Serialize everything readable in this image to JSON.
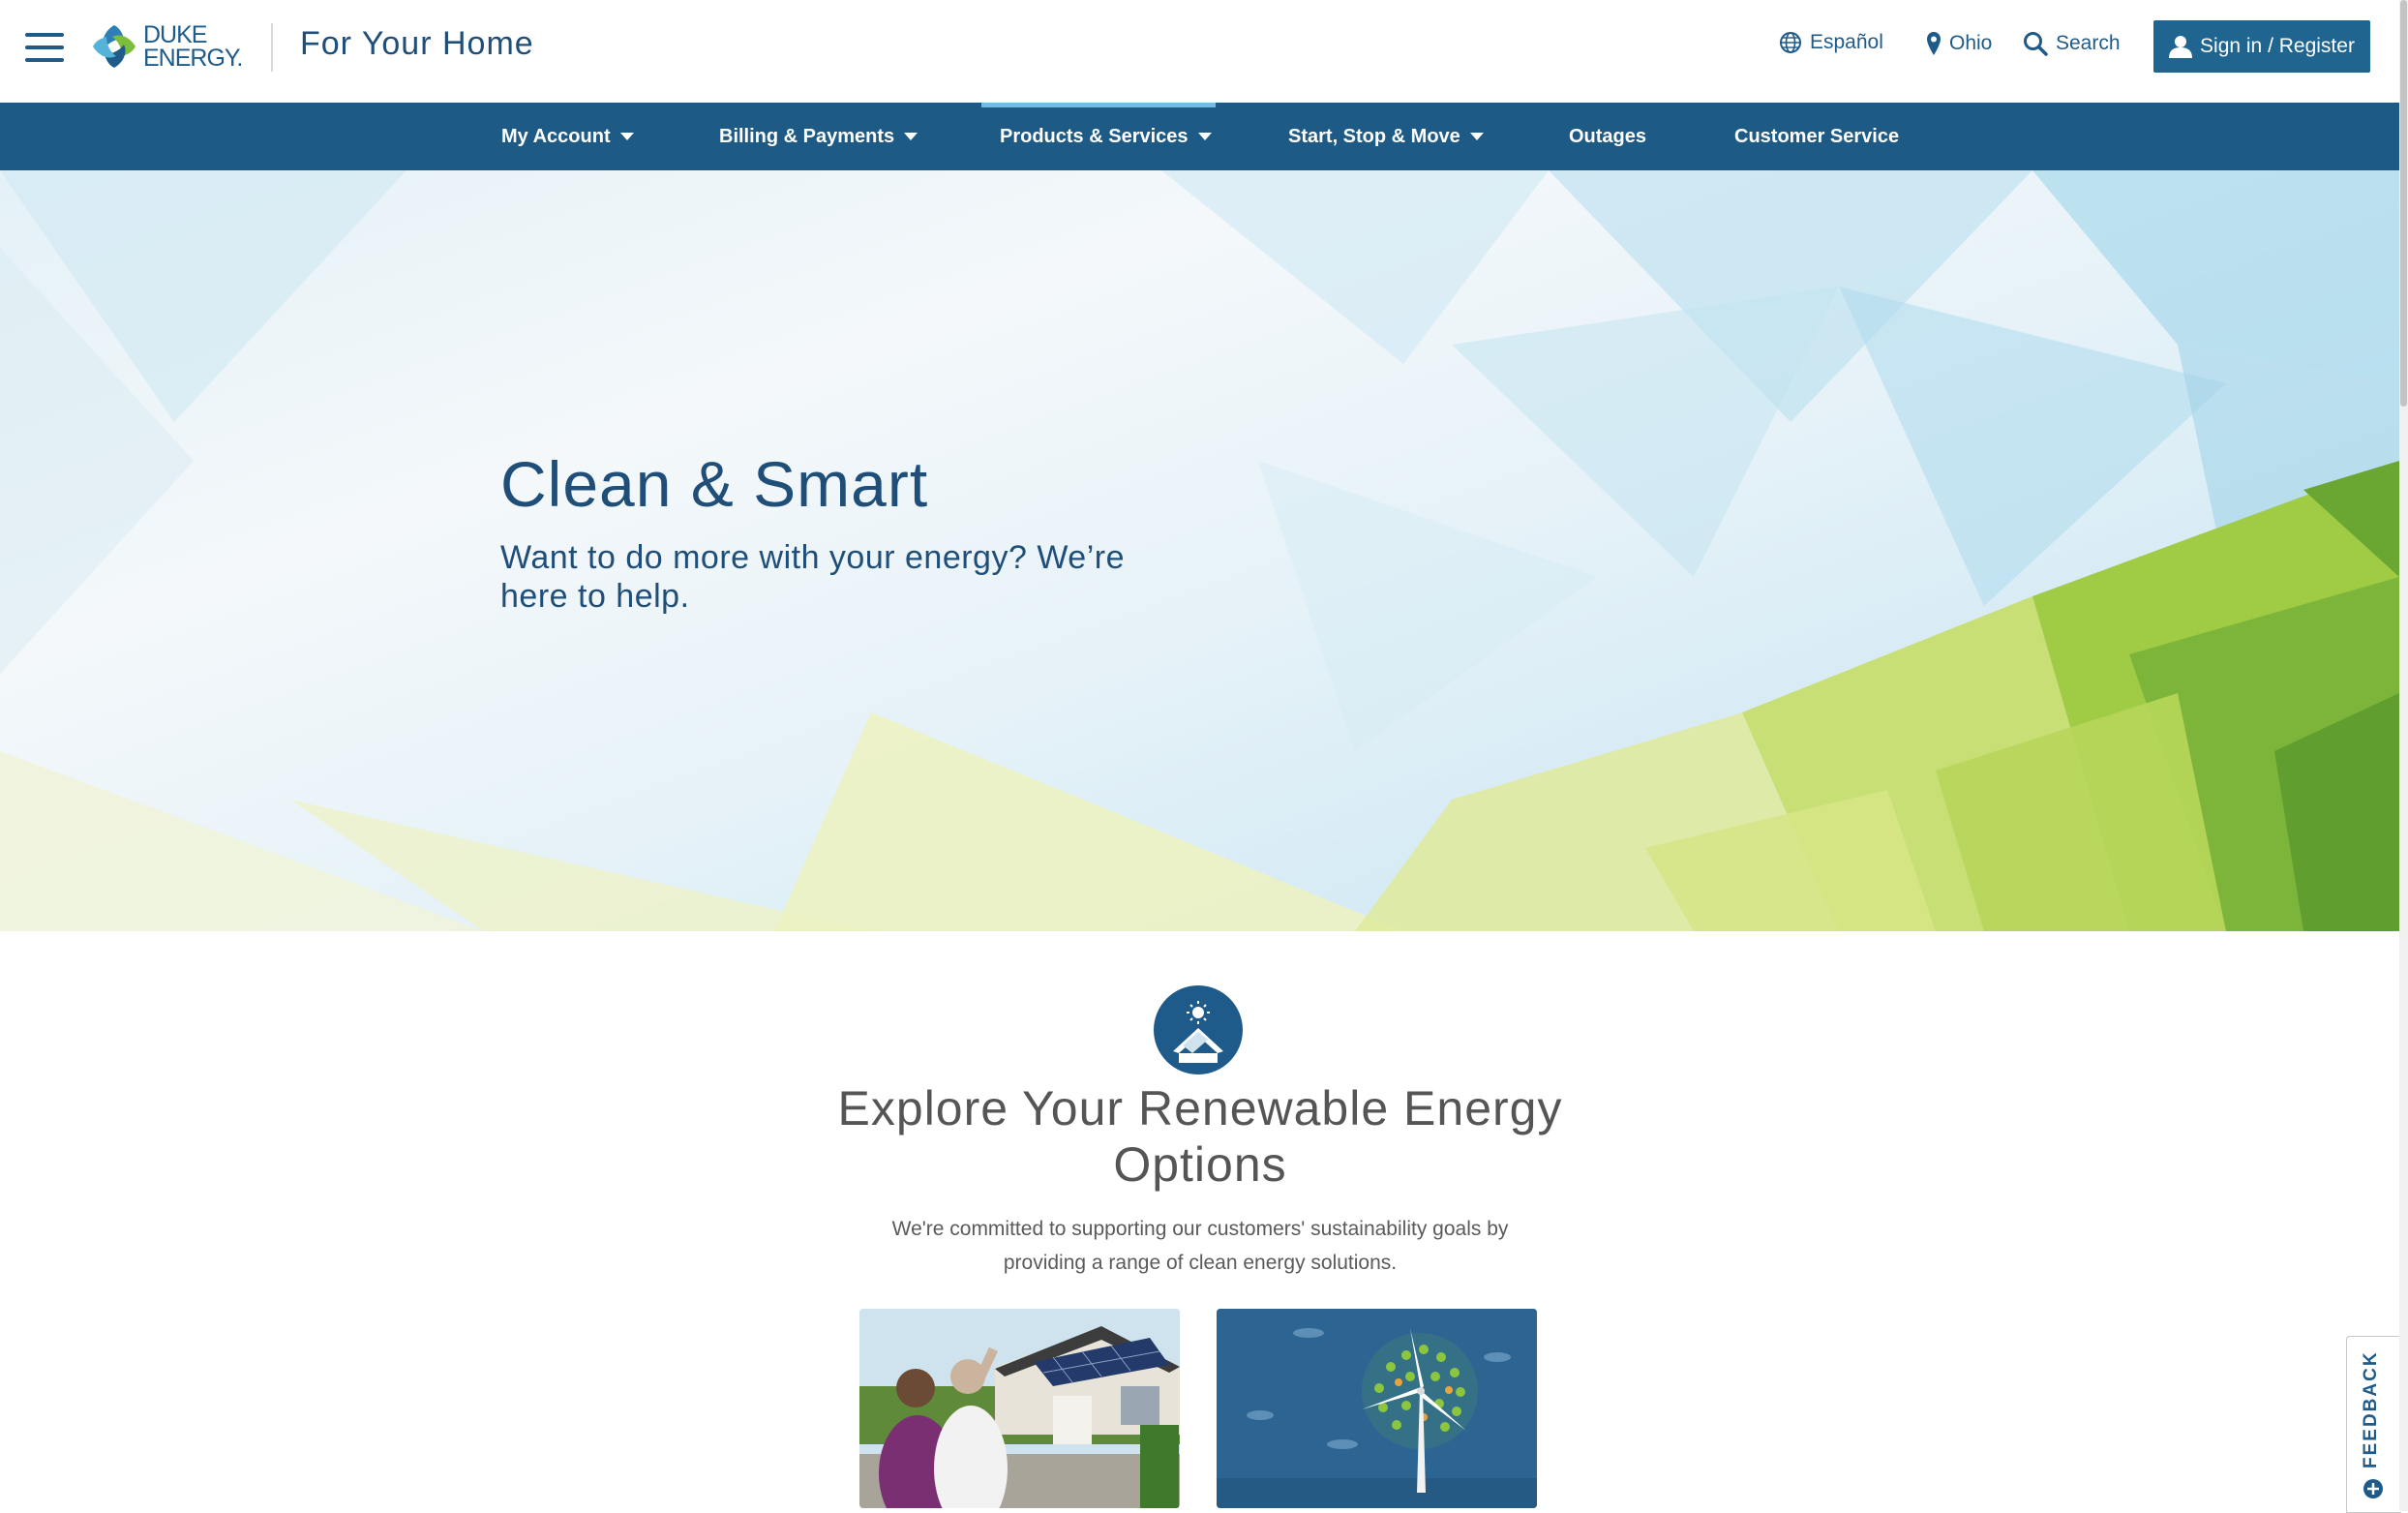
{
  "header": {
    "logo_line1": "DUKE",
    "logo_line2": "ENERGY.",
    "section_title": "For Your Home",
    "espanol": "Español",
    "location": "Ohio",
    "search": "Search",
    "signin": "Sign in / Register"
  },
  "nav": {
    "items": [
      {
        "label": "My Account",
        "dropdown": true
      },
      {
        "label": "Billing & Payments",
        "dropdown": true
      },
      {
        "label": "Products & Services",
        "dropdown": true,
        "active": true
      },
      {
        "label": "Start, Stop & Move",
        "dropdown": true
      },
      {
        "label": "Outages",
        "dropdown": false
      },
      {
        "label": "Customer Service",
        "dropdown": false
      }
    ]
  },
  "hero": {
    "title": "Clean & Smart",
    "subtitle": "Want to do more with your energy? We’re here to help."
  },
  "explore": {
    "icon": "solar-house-icon",
    "title": "Explore Your Renewable Energy Options",
    "description": "We're committed to supporting our customers' sustainability goals by providing a range of clean energy solutions.",
    "cards": [
      {
        "icon": "solar-home-photo"
      },
      {
        "icon": "wind-turbine-illustration"
      }
    ]
  },
  "feedback": {
    "label": "FEEDBACK"
  },
  "colors": {
    "brand_blue": "#1d5a86",
    "accent_light_blue": "#6bbfe6",
    "text_dark_blue": "#1f4e79",
    "hero_green": "#7db53a"
  }
}
